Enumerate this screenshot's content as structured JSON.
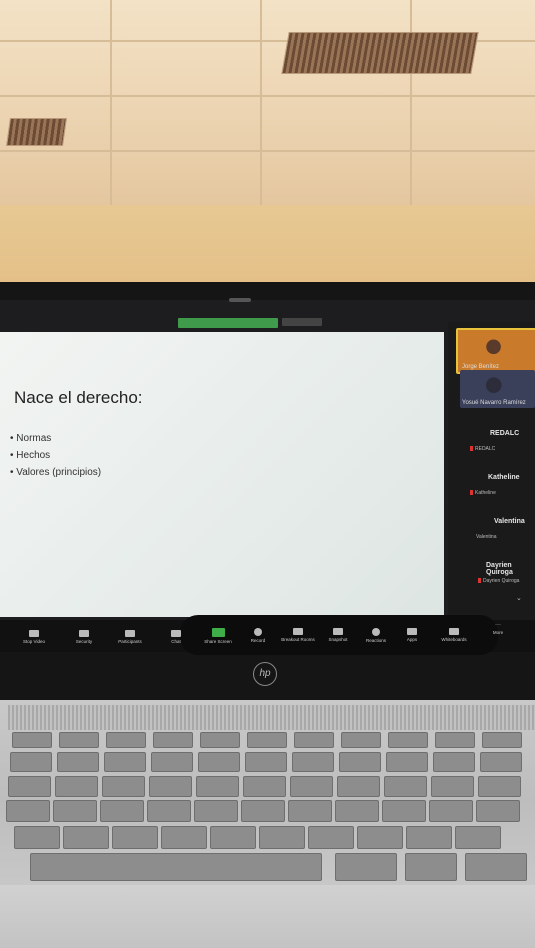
{
  "slide": {
    "title": "Nace el derecho:",
    "bullets": [
      "• Normas",
      "• Hechos",
      "• Valores (principios)"
    ]
  },
  "participants": [
    {
      "name": "Jorge Benítez"
    },
    {
      "name": "Yosué Navarro Ramírez"
    },
    {
      "title": "REDALC",
      "sub": "REDALC"
    },
    {
      "title": "Katheline",
      "sub": "Katheline"
    },
    {
      "title": "Valentina",
      "sub": "Valentina"
    },
    {
      "title": "Dayrien Quiroga",
      "sub": "Dayrien Quiroga"
    }
  ],
  "toolbar": [
    {
      "label": "Stop Video"
    },
    {
      "label": "Security"
    },
    {
      "label": "Participants"
    },
    {
      "label": "Chat"
    },
    {
      "label": "Share Screen"
    },
    {
      "label": "Record"
    },
    {
      "label": "Breakout Rooms"
    },
    {
      "label": "Snapshot"
    },
    {
      "label": "Reactions"
    },
    {
      "label": "Apps"
    },
    {
      "label": "Whiteboards"
    },
    {
      "label": "More"
    }
  ],
  "brand": {
    "logo": "hp"
  },
  "colors": {
    "share_banner": "#3f9a4c",
    "slide_bg": "#eef2f0",
    "toolbar_bg": "#111111"
  }
}
